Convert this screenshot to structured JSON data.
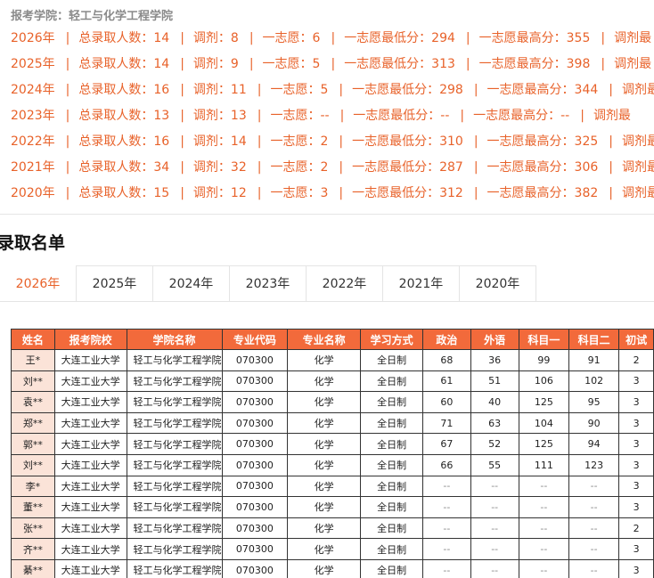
{
  "college_line": "报考学院：轻工与化学工程学院",
  "stats": [
    {
      "year": "2026年",
      "total": "总录取人数：14",
      "adjust": "调剂：8",
      "first": "一志愿：6",
      "min": "一志愿最低分：294",
      "max": "一志愿最高分：355",
      "adjust_min": "调剂最"
    },
    {
      "year": "2025年",
      "total": "总录取人数：14",
      "adjust": "调剂：9",
      "first": "一志愿：5",
      "min": "一志愿最低分：313",
      "max": "一志愿最高分：398",
      "adjust_min": "调剂最"
    },
    {
      "year": "2024年",
      "total": "总录取人数：16",
      "adjust": "调剂：11",
      "first": "一志愿：5",
      "min": "一志愿最低分：298",
      "max": "一志愿最高分：344",
      "adjust_min": "调剂最"
    },
    {
      "year": "2023年",
      "total": "总录取人数：13",
      "adjust": "调剂：13",
      "first": "一志愿：--",
      "min": "一志愿最低分：--",
      "max": "一志愿最高分：--",
      "adjust_min": "调剂最"
    },
    {
      "year": "2022年",
      "total": "总录取人数：16",
      "adjust": "调剂：14",
      "first": "一志愿：2",
      "min": "一志愿最低分：310",
      "max": "一志愿最高分：325",
      "adjust_min": "调剂最"
    },
    {
      "year": "2021年",
      "total": "总录取人数：34",
      "adjust": "调剂：32",
      "first": "一志愿：2",
      "min": "一志愿最低分：287",
      "max": "一志愿最高分：306",
      "adjust_min": "调剂最"
    },
    {
      "year": "2020年",
      "total": "总录取人数：15",
      "adjust": "调剂：12",
      "first": "一志愿：3",
      "min": "一志愿最低分：312",
      "max": "一志愿最高分：382",
      "adjust_min": "调剂最"
    }
  ],
  "section_title": "录取名单",
  "tabs": [
    "2026年",
    "2025年",
    "2024年",
    "2023年",
    "2022年",
    "2021年",
    "2020年"
  ],
  "table": {
    "headers": [
      "姓名",
      "报考院校",
      "学院名称",
      "专业代码",
      "专业名称",
      "学习方式",
      "政治",
      "外语",
      "科目一",
      "科目二",
      "初试"
    ],
    "rows": [
      [
        "王*",
        "大连工业大学",
        "轻工与化学工程学院",
        "070300",
        "化学",
        "全日制",
        "68",
        "36",
        "99",
        "91",
        "2"
      ],
      [
        "刘**",
        "大连工业大学",
        "轻工与化学工程学院",
        "070300",
        "化学",
        "全日制",
        "61",
        "51",
        "106",
        "102",
        "3"
      ],
      [
        "袁**",
        "大连工业大学",
        "轻工与化学工程学院",
        "070300",
        "化学",
        "全日制",
        "60",
        "40",
        "125",
        "95",
        "3"
      ],
      [
        "郑**",
        "大连工业大学",
        "轻工与化学工程学院",
        "070300",
        "化学",
        "全日制",
        "71",
        "63",
        "104",
        "90",
        "3"
      ],
      [
        "郭**",
        "大连工业大学",
        "轻工与化学工程学院",
        "070300",
        "化学",
        "全日制",
        "67",
        "52",
        "125",
        "94",
        "3"
      ],
      [
        "刘**",
        "大连工业大学",
        "轻工与化学工程学院",
        "070300",
        "化学",
        "全日制",
        "66",
        "55",
        "111",
        "123",
        "3"
      ],
      [
        "李*",
        "大连工业大学",
        "轻工与化学工程学院",
        "070300",
        "化学",
        "全日制",
        "--",
        "--",
        "--",
        "--",
        "3"
      ],
      [
        "董**",
        "大连工业大学",
        "轻工与化学工程学院",
        "070300",
        "化学",
        "全日制",
        "--",
        "--",
        "--",
        "--",
        "3"
      ],
      [
        "张**",
        "大连工业大学",
        "轻工与化学工程学院",
        "070300",
        "化学",
        "全日制",
        "--",
        "--",
        "--",
        "--",
        "2"
      ],
      [
        "齐**",
        "大连工业大学",
        "轻工与化学工程学院",
        "070300",
        "化学",
        "全日制",
        "--",
        "--",
        "--",
        "--",
        "3"
      ],
      [
        "綦**",
        "大连工业大学",
        "轻工与化学工程学院",
        "070300",
        "化学",
        "全日制",
        "--",
        "--",
        "--",
        "--",
        "3"
      ]
    ]
  },
  "colors": {
    "accent": "#e8622a",
    "header_bg": "#f26a3b",
    "name_cell_bg": "#fbe3d8"
  }
}
